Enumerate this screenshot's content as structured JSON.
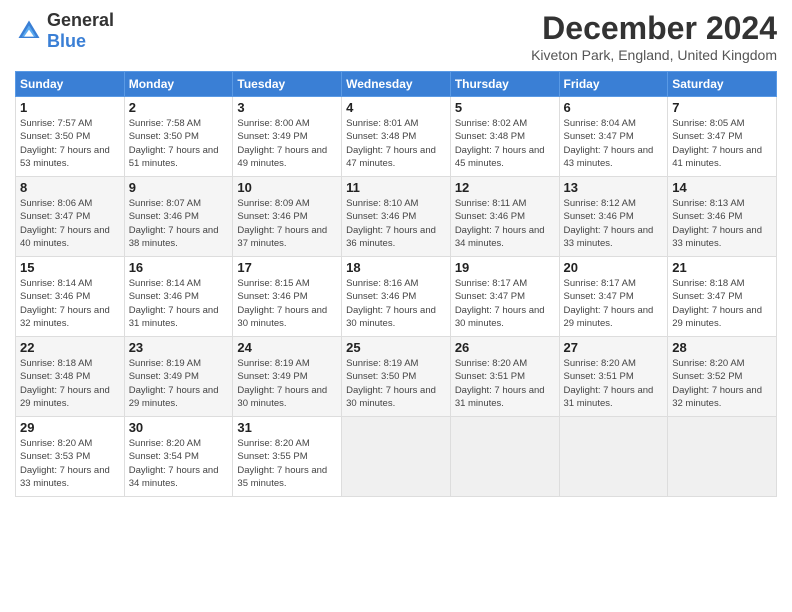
{
  "header": {
    "logo_general": "General",
    "logo_blue": "Blue",
    "month_year": "December 2024",
    "location": "Kiveton Park, England, United Kingdom"
  },
  "days_of_week": [
    "Sunday",
    "Monday",
    "Tuesday",
    "Wednesday",
    "Thursday",
    "Friday",
    "Saturday"
  ],
  "weeks": [
    [
      {
        "day": "1",
        "sunrise": "Sunrise: 7:57 AM",
        "sunset": "Sunset: 3:50 PM",
        "daylight": "Daylight: 7 hours and 53 minutes."
      },
      {
        "day": "2",
        "sunrise": "Sunrise: 7:58 AM",
        "sunset": "Sunset: 3:50 PM",
        "daylight": "Daylight: 7 hours and 51 minutes."
      },
      {
        "day": "3",
        "sunrise": "Sunrise: 8:00 AM",
        "sunset": "Sunset: 3:49 PM",
        "daylight": "Daylight: 7 hours and 49 minutes."
      },
      {
        "day": "4",
        "sunrise": "Sunrise: 8:01 AM",
        "sunset": "Sunset: 3:48 PM",
        "daylight": "Daylight: 7 hours and 47 minutes."
      },
      {
        "day": "5",
        "sunrise": "Sunrise: 8:02 AM",
        "sunset": "Sunset: 3:48 PM",
        "daylight": "Daylight: 7 hours and 45 minutes."
      },
      {
        "day": "6",
        "sunrise": "Sunrise: 8:04 AM",
        "sunset": "Sunset: 3:47 PM",
        "daylight": "Daylight: 7 hours and 43 minutes."
      },
      {
        "day": "7",
        "sunrise": "Sunrise: 8:05 AM",
        "sunset": "Sunset: 3:47 PM",
        "daylight": "Daylight: 7 hours and 41 minutes."
      }
    ],
    [
      {
        "day": "8",
        "sunrise": "Sunrise: 8:06 AM",
        "sunset": "Sunset: 3:47 PM",
        "daylight": "Daylight: 7 hours and 40 minutes."
      },
      {
        "day": "9",
        "sunrise": "Sunrise: 8:07 AM",
        "sunset": "Sunset: 3:46 PM",
        "daylight": "Daylight: 7 hours and 38 minutes."
      },
      {
        "day": "10",
        "sunrise": "Sunrise: 8:09 AM",
        "sunset": "Sunset: 3:46 PM",
        "daylight": "Daylight: 7 hours and 37 minutes."
      },
      {
        "day": "11",
        "sunrise": "Sunrise: 8:10 AM",
        "sunset": "Sunset: 3:46 PM",
        "daylight": "Daylight: 7 hours and 36 minutes."
      },
      {
        "day": "12",
        "sunrise": "Sunrise: 8:11 AM",
        "sunset": "Sunset: 3:46 PM",
        "daylight": "Daylight: 7 hours and 34 minutes."
      },
      {
        "day": "13",
        "sunrise": "Sunrise: 8:12 AM",
        "sunset": "Sunset: 3:46 PM",
        "daylight": "Daylight: 7 hours and 33 minutes."
      },
      {
        "day": "14",
        "sunrise": "Sunrise: 8:13 AM",
        "sunset": "Sunset: 3:46 PM",
        "daylight": "Daylight: 7 hours and 33 minutes."
      }
    ],
    [
      {
        "day": "15",
        "sunrise": "Sunrise: 8:14 AM",
        "sunset": "Sunset: 3:46 PM",
        "daylight": "Daylight: 7 hours and 32 minutes."
      },
      {
        "day": "16",
        "sunrise": "Sunrise: 8:14 AM",
        "sunset": "Sunset: 3:46 PM",
        "daylight": "Daylight: 7 hours and 31 minutes."
      },
      {
        "day": "17",
        "sunrise": "Sunrise: 8:15 AM",
        "sunset": "Sunset: 3:46 PM",
        "daylight": "Daylight: 7 hours and 30 minutes."
      },
      {
        "day": "18",
        "sunrise": "Sunrise: 8:16 AM",
        "sunset": "Sunset: 3:46 PM",
        "daylight": "Daylight: 7 hours and 30 minutes."
      },
      {
        "day": "19",
        "sunrise": "Sunrise: 8:17 AM",
        "sunset": "Sunset: 3:47 PM",
        "daylight": "Daylight: 7 hours and 30 minutes."
      },
      {
        "day": "20",
        "sunrise": "Sunrise: 8:17 AM",
        "sunset": "Sunset: 3:47 PM",
        "daylight": "Daylight: 7 hours and 29 minutes."
      },
      {
        "day": "21",
        "sunrise": "Sunrise: 8:18 AM",
        "sunset": "Sunset: 3:47 PM",
        "daylight": "Daylight: 7 hours and 29 minutes."
      }
    ],
    [
      {
        "day": "22",
        "sunrise": "Sunrise: 8:18 AM",
        "sunset": "Sunset: 3:48 PM",
        "daylight": "Daylight: 7 hours and 29 minutes."
      },
      {
        "day": "23",
        "sunrise": "Sunrise: 8:19 AM",
        "sunset": "Sunset: 3:49 PM",
        "daylight": "Daylight: 7 hours and 29 minutes."
      },
      {
        "day": "24",
        "sunrise": "Sunrise: 8:19 AM",
        "sunset": "Sunset: 3:49 PM",
        "daylight": "Daylight: 7 hours and 30 minutes."
      },
      {
        "day": "25",
        "sunrise": "Sunrise: 8:19 AM",
        "sunset": "Sunset: 3:50 PM",
        "daylight": "Daylight: 7 hours and 30 minutes."
      },
      {
        "day": "26",
        "sunrise": "Sunrise: 8:20 AM",
        "sunset": "Sunset: 3:51 PM",
        "daylight": "Daylight: 7 hours and 31 minutes."
      },
      {
        "day": "27",
        "sunrise": "Sunrise: 8:20 AM",
        "sunset": "Sunset: 3:51 PM",
        "daylight": "Daylight: 7 hours and 31 minutes."
      },
      {
        "day": "28",
        "sunrise": "Sunrise: 8:20 AM",
        "sunset": "Sunset: 3:52 PM",
        "daylight": "Daylight: 7 hours and 32 minutes."
      }
    ],
    [
      {
        "day": "29",
        "sunrise": "Sunrise: 8:20 AM",
        "sunset": "Sunset: 3:53 PM",
        "daylight": "Daylight: 7 hours and 33 minutes."
      },
      {
        "day": "30",
        "sunrise": "Sunrise: 8:20 AM",
        "sunset": "Sunset: 3:54 PM",
        "daylight": "Daylight: 7 hours and 34 minutes."
      },
      {
        "day": "31",
        "sunrise": "Sunrise: 8:20 AM",
        "sunset": "Sunset: 3:55 PM",
        "daylight": "Daylight: 7 hours and 35 minutes."
      },
      null,
      null,
      null,
      null
    ]
  ]
}
